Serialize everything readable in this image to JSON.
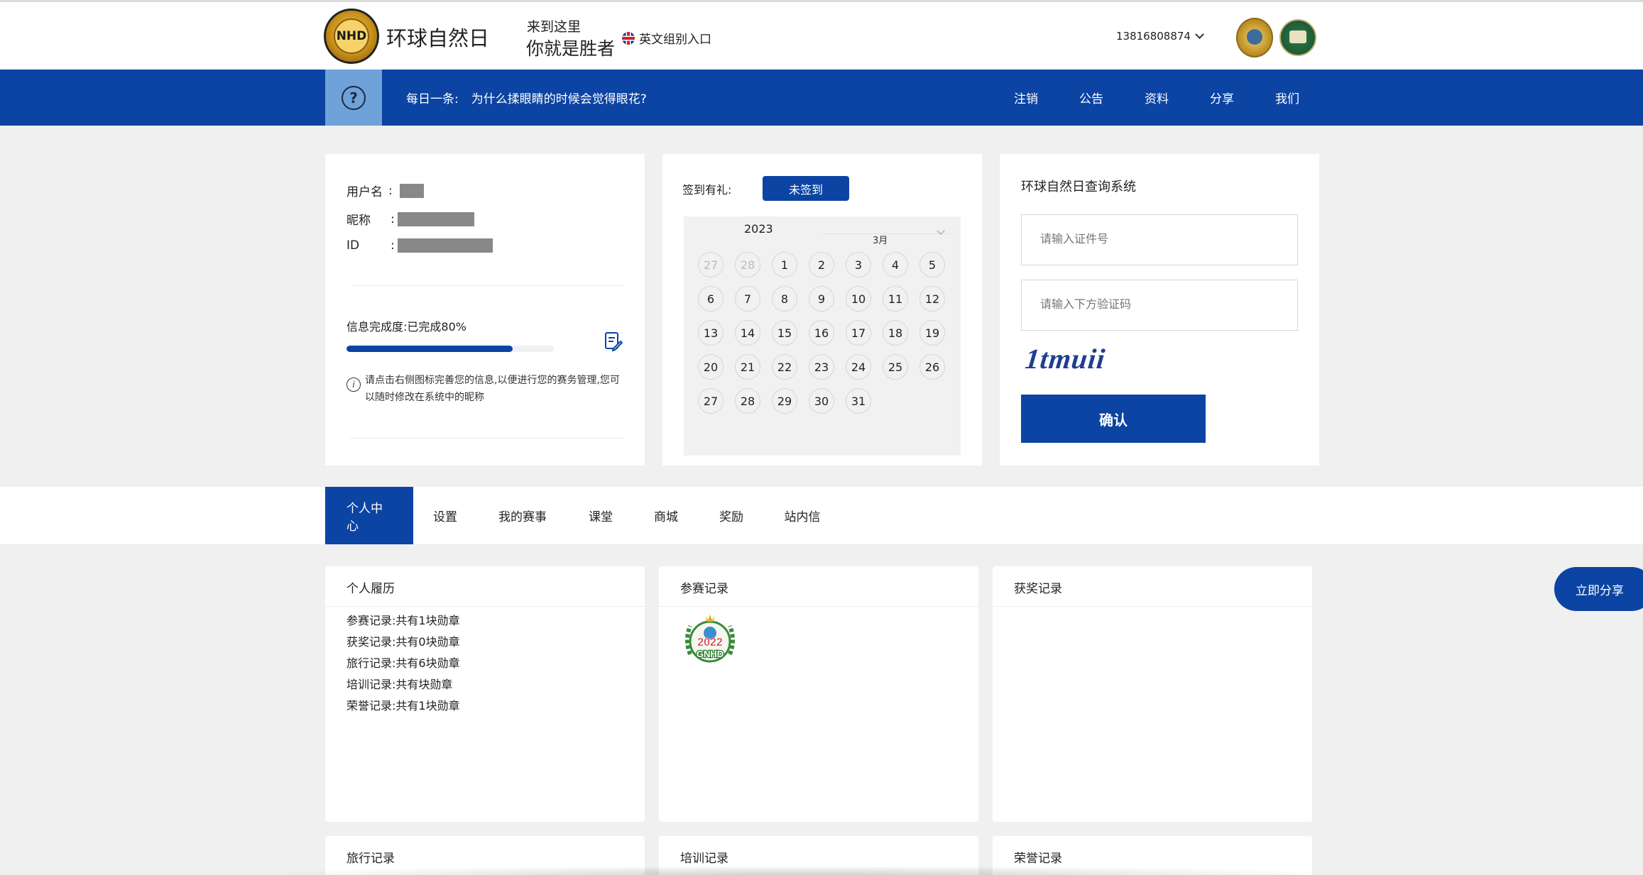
{
  "header": {
    "logo_text": "NHD",
    "site_title": "环球自然日",
    "slogan_line1": "来到这里",
    "slogan_line2": "你就是胜者",
    "english_entry": "英文组别入口",
    "user_phone": "13816808874"
  },
  "nav": {
    "daily_prefix": "每日一条:",
    "daily_question": "为什么揉眼睛的时候会觉得眼花?",
    "links": [
      {
        "label": "注销"
      },
      {
        "label": "公告"
      },
      {
        "label": "资料"
      },
      {
        "label": "分享"
      },
      {
        "label": "我们"
      }
    ]
  },
  "profile": {
    "username_label": "用户名",
    "nickname_label": "昵称",
    "id_label": "ID",
    "colon": ":",
    "completion_label": "信息完成度:已完成80%",
    "completion_value": 0.8,
    "hint": "请点击右侧图标完善您的信息,以便进行您的赛务管理,您可以随时修改在系统中的昵称"
  },
  "checkin": {
    "label": "签到有礼:",
    "button": "未签到",
    "year": "2023",
    "month": "3月",
    "days": [
      {
        "d": "27",
        "muted": true
      },
      {
        "d": "28",
        "muted": true
      },
      {
        "d": "1"
      },
      {
        "d": "2"
      },
      {
        "d": "3"
      },
      {
        "d": "4"
      },
      {
        "d": "5"
      },
      {
        "d": "6"
      },
      {
        "d": "7"
      },
      {
        "d": "8"
      },
      {
        "d": "9"
      },
      {
        "d": "10"
      },
      {
        "d": "11"
      },
      {
        "d": "12"
      },
      {
        "d": "13"
      },
      {
        "d": "14"
      },
      {
        "d": "15"
      },
      {
        "d": "16"
      },
      {
        "d": "17"
      },
      {
        "d": "18"
      },
      {
        "d": "19"
      },
      {
        "d": "20"
      },
      {
        "d": "21"
      },
      {
        "d": "22"
      },
      {
        "d": "23"
      },
      {
        "d": "24"
      },
      {
        "d": "25"
      },
      {
        "d": "26"
      },
      {
        "d": "27"
      },
      {
        "d": "28"
      },
      {
        "d": "29"
      },
      {
        "d": "30"
      },
      {
        "d": "31"
      }
    ]
  },
  "query": {
    "title": "环球自然日查询系统",
    "cert_placeholder": "请输入证件号",
    "captcha_placeholder": "请输入下方验证码",
    "captcha_text": "1tmuii",
    "confirm": "确认"
  },
  "tabs": [
    {
      "label": "个人中心",
      "active": true
    },
    {
      "label": "设置"
    },
    {
      "label": "我的赛事"
    },
    {
      "label": "课堂"
    },
    {
      "label": "商城"
    },
    {
      "label": "奖励"
    },
    {
      "label": "站内信"
    }
  ],
  "panels": {
    "resume": {
      "title": "个人履历",
      "items": [
        "参赛记录:共有1块勋章",
        "获奖记录:共有0块勋章",
        "旅行记录:共有6块勋章",
        "培训记录:共有块勋章",
        "荣誉记录:共有1块勋章"
      ]
    },
    "competition": {
      "title": "参赛记录",
      "medal_year": "2022",
      "medal_text": "GNHD"
    },
    "awards": {
      "title": "获奖记录"
    },
    "travel": {
      "title": "旅行记录"
    },
    "training": {
      "title": "培训记录"
    },
    "honors": {
      "title": "荣誉记录"
    }
  },
  "share_button": "立即分享",
  "colors": {
    "primary": "#0c44a3",
    "background": "#f0f0f0"
  }
}
